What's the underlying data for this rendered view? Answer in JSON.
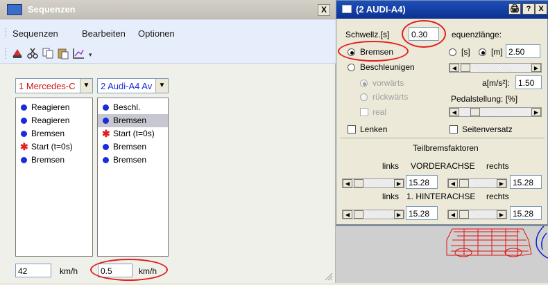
{
  "win1": {
    "title": "Sequenzen",
    "close_label": "X",
    "menu": [
      "Sequenzen",
      "Bearbeiten",
      "Optionen"
    ],
    "combo_left": "1 Mercedes-C",
    "combo_right": "2 Audi-A4 Av",
    "list_left": [
      {
        "icon": "dot",
        "text": "Reagieren"
      },
      {
        "icon": "dot",
        "text": "Reagieren"
      },
      {
        "icon": "dot",
        "text": "Bremsen"
      },
      {
        "icon": "star",
        "text": "Start (t=0s)"
      },
      {
        "icon": "dot",
        "text": "Bremsen"
      }
    ],
    "list_right": [
      {
        "icon": "dot",
        "text": "Beschl."
      },
      {
        "icon": "dot",
        "text": "Bremsen",
        "selected": true
      },
      {
        "icon": "star",
        "text": "Start (t=0s)"
      },
      {
        "icon": "dot",
        "text": "Bremsen"
      },
      {
        "icon": "dot",
        "text": "Bremsen"
      }
    ],
    "speed_left": "42",
    "speed_left_unit": "km/h",
    "speed_right": "0.5",
    "speed_right_unit": "km/h"
  },
  "win2": {
    "title": "(2 AUDI-A4)",
    "btn_print": "🖨",
    "btn_help": "?",
    "btn_close": "X",
    "schwellz_label": "Schwellz.[s]",
    "schwellz_value": "0.30",
    "sequenzlaenge_label": "equenzlänge:",
    "bremsen": "Bremsen",
    "beschleunigen": "Beschleunigen",
    "unit_s": "[s]",
    "unit_m": "[m]",
    "length_value": "2.50",
    "vorwaerts": "vorwärts",
    "rueckwaerts": "rückwärts",
    "real": "real",
    "a_label": "a[m/s²]:",
    "a_value": "1.50",
    "pedal_label": "Pedalstellung: [%]",
    "lenken": "Lenken",
    "seitenversatz": "Seitenversatz",
    "teilbrems": "Teilbremsfaktoren",
    "links": "links",
    "rechts": "rechts",
    "vorderachse": "VORDERACHSE",
    "hinterachse": "1. HINTERACHSE",
    "v_left": "15.28",
    "v_right": "15.28",
    "h_left": "15.28",
    "h_right": "15.28"
  }
}
